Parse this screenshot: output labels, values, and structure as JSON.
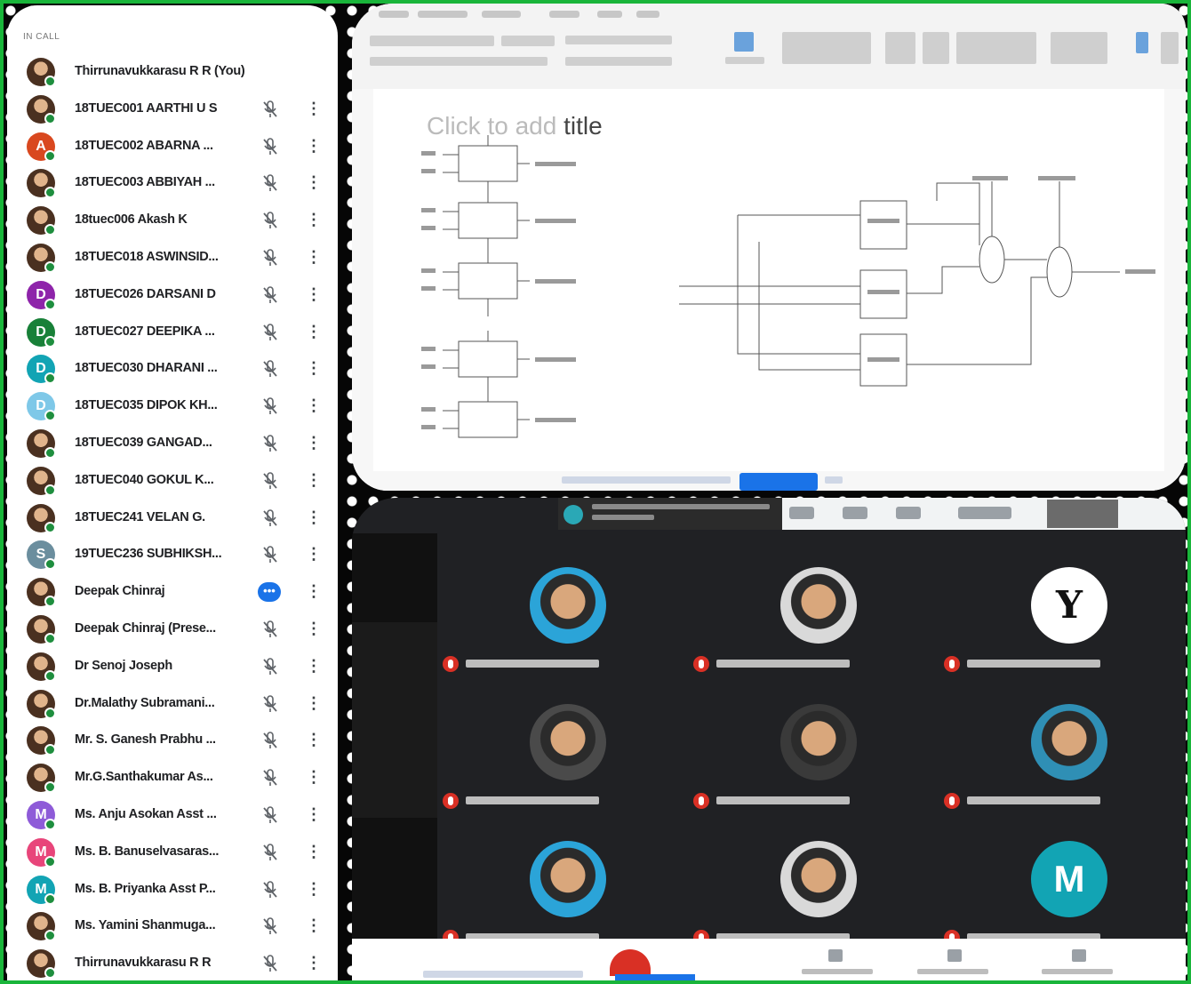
{
  "colors": {
    "frame_accent": "#19b53a",
    "meet_dark": "#202124",
    "speaking_blue": "#1a73e8",
    "online_green": "#1e8e3e",
    "mic_red": "#d93025"
  },
  "participants_panel": {
    "section_label": "IN CALL",
    "participants": [
      {
        "name": "Thirrunavukkarasu R R (You)",
        "avatar": "photo",
        "status": "none"
      },
      {
        "name": "18TUEC001 AARTHI U S",
        "avatar": "photo",
        "status": "muted"
      },
      {
        "name": "18TUEC002 ABARNA ...",
        "avatar": "A",
        "avatar_color": "#d9481f",
        "status": "muted"
      },
      {
        "name": "18TUEC003 ABBIYAH ...",
        "avatar": "photo",
        "status": "muted"
      },
      {
        "name": "18tuec006 Akash K",
        "avatar": "photo",
        "status": "muted"
      },
      {
        "name": "18TUEC018 ASWINSID...",
        "avatar": "photo",
        "status": "muted"
      },
      {
        "name": "18TUEC026 DARSANI D",
        "avatar": "D",
        "avatar_color": "#8e24aa",
        "status": "muted"
      },
      {
        "name": "18TUEC027 DEEPIKA ...",
        "avatar": "D",
        "avatar_color": "#188038",
        "status": "muted"
      },
      {
        "name": "18TUEC030 DHARANI ...",
        "avatar": "D",
        "avatar_color": "#12a4b4",
        "status": "muted"
      },
      {
        "name": "18TUEC035 DIPOK KH...",
        "avatar": "D",
        "avatar_color": "#7ec8e8",
        "status": "muted"
      },
      {
        "name": "18TUEC039 GANGAD...",
        "avatar": "photo",
        "status": "muted"
      },
      {
        "name": "18TUEC040 GOKUL K...",
        "avatar": "photo",
        "status": "muted"
      },
      {
        "name": "18TUEC241 VELAN G.",
        "avatar": "photo",
        "status": "muted"
      },
      {
        "name": "19TUEC236 SUBHIKSH...",
        "avatar": "S",
        "avatar_color": "#6b8e9e",
        "status": "muted"
      },
      {
        "name": "Deepak Chinraj",
        "avatar": "photo",
        "status": "speaking"
      },
      {
        "name": "Deepak Chinraj (Prese...",
        "avatar": "photo",
        "status": "muted"
      },
      {
        "name": "Dr Senoj Joseph",
        "avatar": "photo",
        "status": "muted"
      },
      {
        "name": "Dr.Malathy Subramani...",
        "avatar": "photo",
        "status": "muted"
      },
      {
        "name": "Mr. S. Ganesh Prabhu ...",
        "avatar": "photo",
        "status": "muted"
      },
      {
        "name": "Mr.G.Santhakumar As...",
        "avatar": "photo",
        "status": "muted"
      },
      {
        "name": "Ms. Anju Asokan Asst ...",
        "avatar": "M",
        "avatar_color": "#8e5bd8",
        "status": "muted"
      },
      {
        "name": "Ms. B. Banuselvasaras...",
        "avatar": "M",
        "avatar_color": "#e8457a",
        "status": "muted"
      },
      {
        "name": "Ms. B. Priyanka Asst P...",
        "avatar": "M",
        "avatar_color": "#12a4b4",
        "status": "muted"
      },
      {
        "name": "Ms. Yamini Shanmuga...",
        "avatar": "photo",
        "status": "muted"
      },
      {
        "name": "Thirrunavukkarasu R R",
        "avatar": "photo",
        "status": "muted"
      }
    ]
  },
  "slide": {
    "title_placeholder_faded": "Click to add",
    "title_placeholder_word": "title"
  },
  "meet_grid": {
    "tiles": [
      {
        "avatar": "photo",
        "color": "#2ba4d8"
      },
      {
        "avatar": "photo",
        "color": "#d9d9d9"
      },
      {
        "avatar": "logo",
        "color": "#ffffff"
      },
      {
        "avatar": "photo",
        "color": "#4a4a4a"
      },
      {
        "avatar": "photo",
        "color": "#3a3a3a"
      },
      {
        "avatar": "photo",
        "color": "#2f8fb5"
      },
      {
        "avatar": "photo",
        "color": "#2ba4d8"
      },
      {
        "avatar": "photo",
        "color": "#d9d9d9"
      },
      {
        "avatar": "M",
        "color": "#12a4b4"
      }
    ]
  }
}
